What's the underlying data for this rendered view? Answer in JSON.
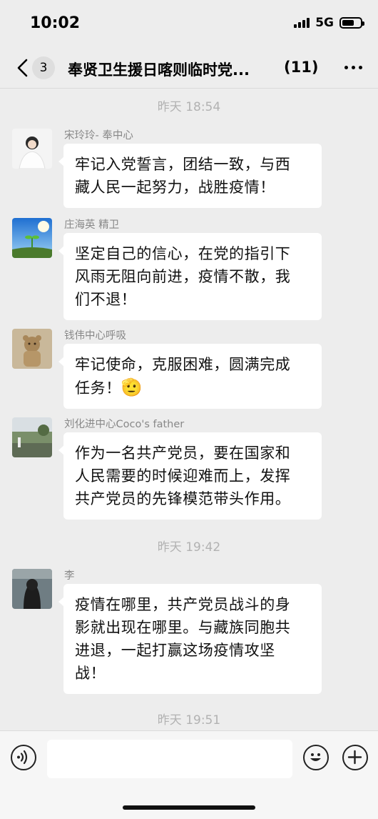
{
  "status_bar": {
    "time": "10:02",
    "network": "5G"
  },
  "header": {
    "unread_count": "3",
    "title": "奉贤卫生援日喀则临时党...",
    "member_count": "(11)"
  },
  "time_separators": [
    "昨天 18:54",
    "昨天 19:42",
    "昨天 19:51"
  ],
  "messages": [
    {
      "sender": "宋玲玲- 奉中心",
      "lines": [
        "牢记入党誓言，团结一致，与西",
        "藏人民一起努力，战胜疫情！"
      ]
    },
    {
      "sender": "庄海英 精卫",
      "lines": [
        "坚定自己的信心，在党的指引下",
        "风雨无阻向前进，疫情不散，我",
        "们不退！"
      ]
    },
    {
      "sender": "钱伟中心呼吸",
      "lines": [
        "牢记使命，克服困难，圆满完成",
        "任务！"
      ],
      "emoji": "🫡"
    },
    {
      "sender": "刘化进中心Coco's father",
      "lines": [
        "作为一名共产党员，要在国家和",
        "人民需要的时候迎难而上，发挥",
        "共产党员的先锋模范带头作用。"
      ]
    },
    {
      "sender": "李",
      "lines": [
        "疫情在哪里，共产党员战斗的身",
        "影就出现在哪里。与藏族同胞共",
        "进退，一起打赢这场疫情攻坚",
        "战！"
      ]
    }
  ],
  "input": {
    "placeholder": ""
  },
  "icons": {
    "back": "chevron-left-icon",
    "more": "more-dots-icon",
    "voice": "voice-icon",
    "emoji": "emoji-icon",
    "add": "plus-icon"
  }
}
